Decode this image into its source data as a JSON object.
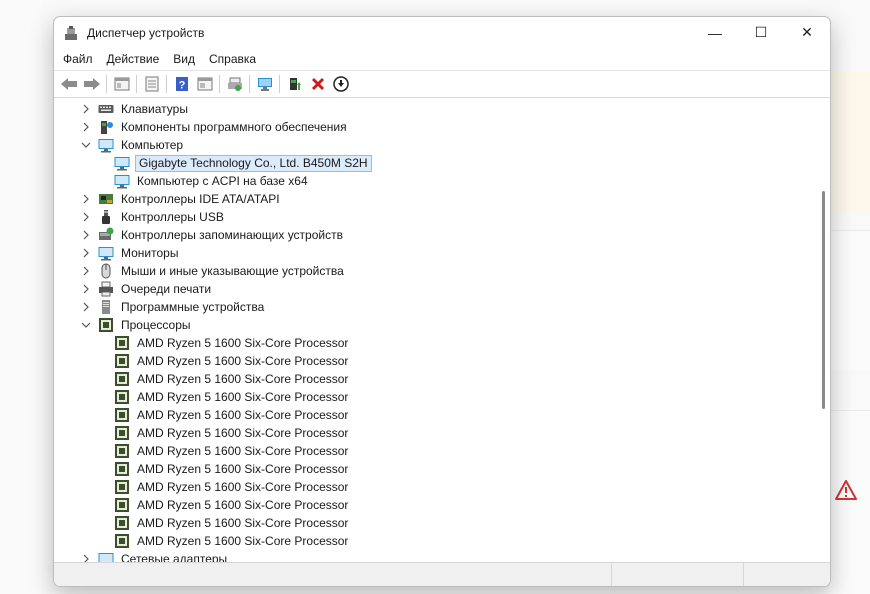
{
  "window": {
    "title": "Диспетчер устройств",
    "controls": {
      "minimize": "—",
      "maximize": "☐",
      "close": "✕"
    }
  },
  "menu": [
    {
      "label": "Файл"
    },
    {
      "label": "Действие"
    },
    {
      "label": "Вид"
    },
    {
      "label": "Справка"
    }
  ],
  "toolbar": [
    {
      "icon": "back-arrow-icon"
    },
    {
      "icon": "forward-arrow-icon"
    },
    {
      "icon": "properties-icon"
    },
    {
      "icon": "driver-details-icon"
    },
    {
      "icon": "help-icon"
    },
    {
      "icon": "view-icon"
    },
    {
      "icon": "print-icon"
    },
    {
      "icon": "scan-hardware-icon"
    },
    {
      "icon": "update-driver-icon"
    },
    {
      "icon": "uninstall-device-icon"
    },
    {
      "icon": "disable-device-icon"
    }
  ],
  "tree": [
    {
      "label": "Клавиатуры",
      "icon": "keyboard-icon",
      "level": 0,
      "expander": "collapsed"
    },
    {
      "label": "Компоненты программного обеспечения",
      "icon": "software-component-icon",
      "level": 0,
      "expander": "collapsed"
    },
    {
      "label": "Компьютер",
      "icon": "computer-icon",
      "level": 0,
      "expander": "expanded"
    },
    {
      "label": "Gigabyte Technology Co., Ltd. B450M S2H",
      "icon": "monitor-icon",
      "level": 1,
      "expander": "none",
      "selected": true
    },
    {
      "label": "Компьютер с ACPI на базе x64",
      "icon": "monitor-icon",
      "level": 1,
      "expander": "none"
    },
    {
      "label": "Контроллеры IDE ATA/ATAPI",
      "icon": "ide-controller-icon",
      "level": 0,
      "expander": "collapsed"
    },
    {
      "label": "Контроллеры USB",
      "icon": "usb-icon",
      "level": 0,
      "expander": "collapsed"
    },
    {
      "label": "Контроллеры запоминающих устройств",
      "icon": "storage-controller-icon",
      "level": 0,
      "expander": "collapsed"
    },
    {
      "label": "Мониторы",
      "icon": "monitor-icon",
      "level": 0,
      "expander": "collapsed"
    },
    {
      "label": "Мыши и иные указывающие устройства",
      "icon": "mouse-icon",
      "level": 0,
      "expander": "collapsed"
    },
    {
      "label": "Очереди печати",
      "icon": "printer-icon",
      "level": 0,
      "expander": "collapsed"
    },
    {
      "label": "Программные устройства",
      "icon": "software-device-icon",
      "level": 0,
      "expander": "collapsed"
    },
    {
      "label": "Процессоры",
      "icon": "processor-icon",
      "level": 0,
      "expander": "expanded"
    },
    {
      "label": "AMD Ryzen 5 1600 Six-Core Processor",
      "icon": "processor-icon",
      "level": 1,
      "expander": "none"
    },
    {
      "label": "AMD Ryzen 5 1600 Six-Core Processor",
      "icon": "processor-icon",
      "level": 1,
      "expander": "none"
    },
    {
      "label": "AMD Ryzen 5 1600 Six-Core Processor",
      "icon": "processor-icon",
      "level": 1,
      "expander": "none"
    },
    {
      "label": "AMD Ryzen 5 1600 Six-Core Processor",
      "icon": "processor-icon",
      "level": 1,
      "expander": "none"
    },
    {
      "label": "AMD Ryzen 5 1600 Six-Core Processor",
      "icon": "processor-icon",
      "level": 1,
      "expander": "none"
    },
    {
      "label": "AMD Ryzen 5 1600 Six-Core Processor",
      "icon": "processor-icon",
      "level": 1,
      "expander": "none"
    },
    {
      "label": "AMD Ryzen 5 1600 Six-Core Processor",
      "icon": "processor-icon",
      "level": 1,
      "expander": "none"
    },
    {
      "label": "AMD Ryzen 5 1600 Six-Core Processor",
      "icon": "processor-icon",
      "level": 1,
      "expander": "none"
    },
    {
      "label": "AMD Ryzen 5 1600 Six-Core Processor",
      "icon": "processor-icon",
      "level": 1,
      "expander": "none"
    },
    {
      "label": "AMD Ryzen 5 1600 Six-Core Processor",
      "icon": "processor-icon",
      "level": 1,
      "expander": "none"
    },
    {
      "label": "AMD Ryzen 5 1600 Six-Core Processor",
      "icon": "processor-icon",
      "level": 1,
      "expander": "none"
    },
    {
      "label": "AMD Ryzen 5 1600 Six-Core Processor",
      "icon": "processor-icon",
      "level": 1,
      "expander": "none"
    },
    {
      "label": "Сетевые адаптеры",
      "icon": "network-adapter-icon",
      "level": 0,
      "expander": "collapsed"
    }
  ],
  "colors": {
    "selection_bg": "#dcebfc",
    "selection_border": "#90c0ea",
    "warning": "#d13438"
  }
}
